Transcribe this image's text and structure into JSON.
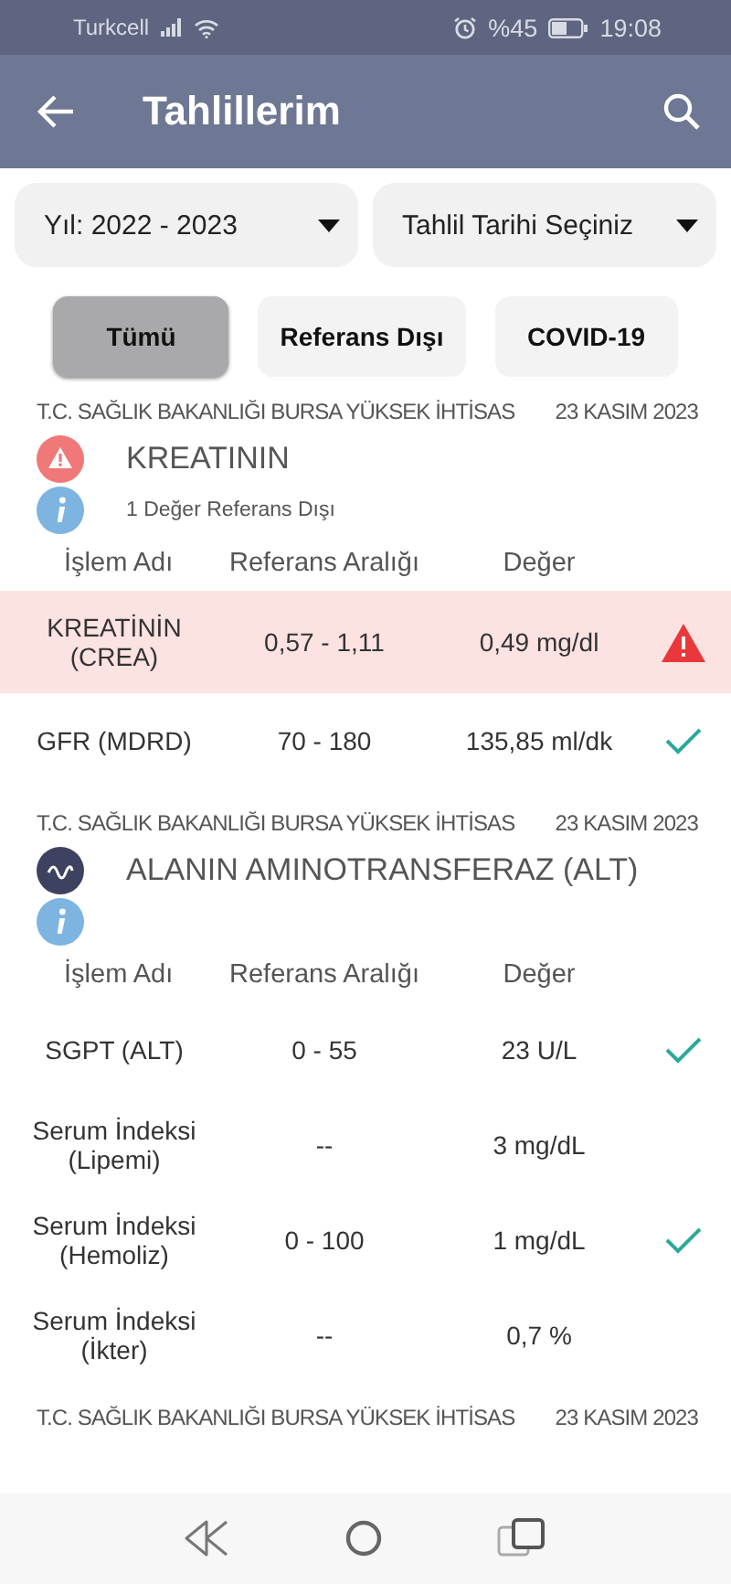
{
  "status_bar": {
    "carrier": "Turkcell",
    "battery": "%45",
    "time": "19:08"
  },
  "app_bar": {
    "title": "Tahlillerim"
  },
  "dropdowns": [
    {
      "label": "Yıl: 2022 - 2023"
    },
    {
      "label": "Tahlil Tarihi Seçiniz"
    }
  ],
  "filters": [
    {
      "label": "Tümü",
      "selected": true
    },
    {
      "label": "Referans Dışı",
      "selected": false
    },
    {
      "label": "COVID-19",
      "selected": false
    }
  ],
  "sections": [
    {
      "institution": "T.C. SAĞLIK BAKANLIĞI BURSA YÜKSEK İHTİSAS",
      "date": "23 KASIM 2023",
      "kind": "warning",
      "title": "KREATININ",
      "note": "1 Değer Referans Dışı",
      "columns": [
        "İşlem Adı",
        "Referans Aralığı",
        "Değer"
      ],
      "rows": [
        {
          "name": "KREATİNİN (CREA)",
          "range": "0,57 - 1,11",
          "value": "0,49 mg/dl",
          "kind": "out"
        },
        {
          "name": "GFR (MDRD)",
          "range": "70 - 180",
          "value": "135,85 ml/dk",
          "kind": "normal"
        }
      ]
    },
    {
      "institution": "T.C. SAĞLIK BAKANLIĞI BURSA YÜKSEK İHTİSAS",
      "date": "23 KASIM 2023",
      "kind": "trend",
      "title": "ALANIN AMINOTRANSFERAZ (ALT)",
      "columns": [
        "İşlem Adı",
        "Referans Aralığı",
        "Değer"
      ],
      "rows": [
        {
          "name": "SGPT (ALT)",
          "range": "0 - 55",
          "value": "23 U/L",
          "kind": "normal"
        },
        {
          "name": "Serum İndeksi (Lipemi)",
          "range": "--",
          "value": "3 mg/dL",
          "kind": "plain"
        },
        {
          "name": "Serum İndeksi (Hemoliz)",
          "range": "0 - 100",
          "value": "1 mg/dL",
          "kind": "normal"
        },
        {
          "name": "Serum İndeksi (İkter)",
          "range": "--",
          "value": "0,7 %",
          "kind": "plain"
        }
      ]
    },
    {
      "institution": "T.C. SAĞLIK BAKANLIĞI BURSA YÜKSEK İHTİSAS",
      "date": "23 KASIM 2023"
    }
  ]
}
